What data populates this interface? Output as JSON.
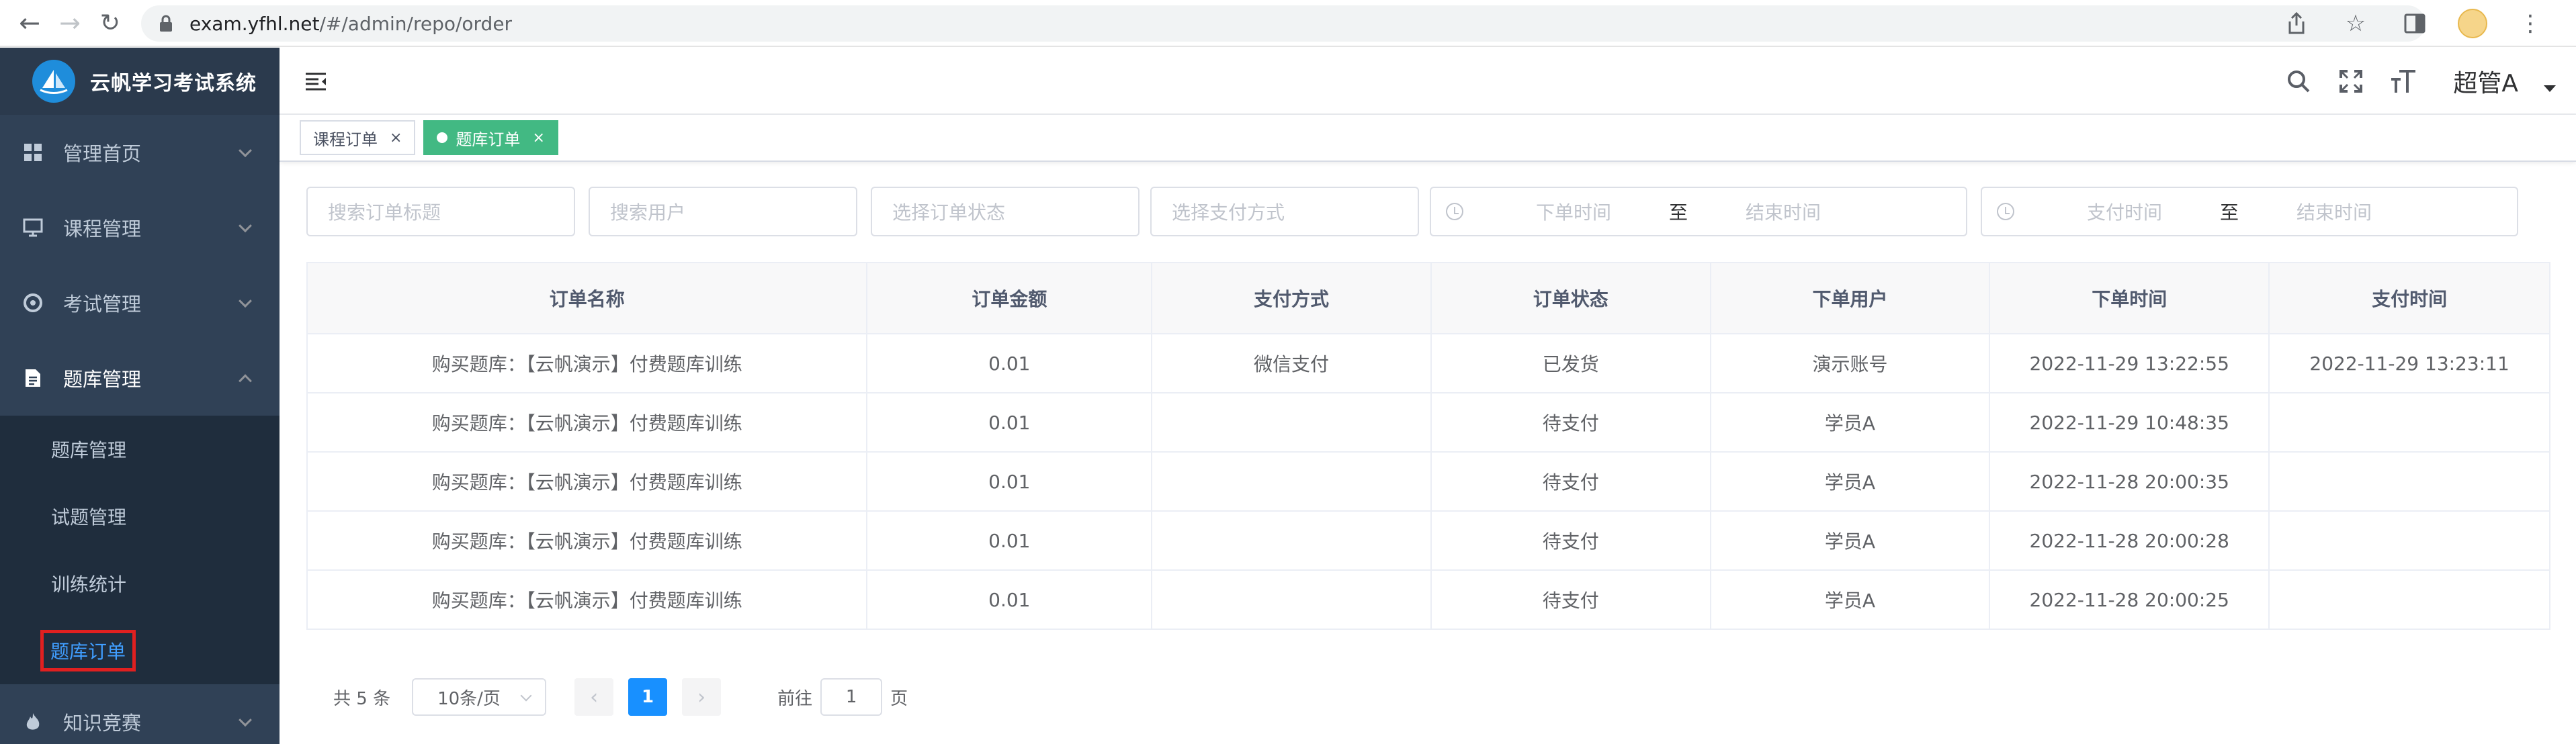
{
  "browser": {
    "domain": "exam.yfhl.net",
    "path": "/#/admin/repo/order"
  },
  "brand": {
    "title": "云帆学习考试系统"
  },
  "sidebar": {
    "items": [
      {
        "label": "管理首页",
        "icon": "dashboard-icon"
      },
      {
        "label": "课程管理",
        "icon": "monitor-icon"
      },
      {
        "label": "考试管理",
        "icon": "exam-icon"
      },
      {
        "label": "题库管理",
        "icon": "document-icon",
        "expanded": true
      }
    ],
    "submenu": [
      {
        "label": "题库管理"
      },
      {
        "label": "试题管理"
      },
      {
        "label": "训练统计"
      },
      {
        "label": "题库订单",
        "active": true
      }
    ],
    "after": [
      {
        "label": "知识竞赛",
        "icon": "fire-icon"
      }
    ]
  },
  "header": {
    "user": "超管A"
  },
  "tags": [
    {
      "label": "课程订单",
      "close": "×"
    },
    {
      "label": "题库订单",
      "close": "×",
      "active": true
    }
  ],
  "filters": {
    "title_placeholder": "搜索订单标题",
    "user_placeholder": "搜索用户",
    "status_placeholder": "选择订单状态",
    "pay_placeholder": "选择支付方式",
    "order_start": "下单时间",
    "order_end": "结束时间",
    "pay_start": "支付时间",
    "pay_end": "结束时间",
    "range_sep": "至"
  },
  "table": {
    "columns": [
      "订单名称",
      "订单金额",
      "支付方式",
      "订单状态",
      "下单用户",
      "下单时间",
      "支付时间"
    ],
    "rows": [
      [
        "购买题库：【云帆演示】付费题库训练",
        "0.01",
        "微信支付",
        "已发货",
        "演示账号",
        "2022-11-29 13:22:55",
        "2022-11-29 13:23:11"
      ],
      [
        "购买题库：【云帆演示】付费题库训练",
        "0.01",
        "",
        "待支付",
        "学员A",
        "2022-11-29 10:48:35",
        ""
      ],
      [
        "购买题库：【云帆演示】付费题库训练",
        "0.01",
        "",
        "待支付",
        "学员A",
        "2022-11-28 20:00:35",
        ""
      ],
      [
        "购买题库：【云帆演示】付费题库训练",
        "0.01",
        "",
        "待支付",
        "学员A",
        "2022-11-28 20:00:28",
        ""
      ],
      [
        "购买题库：【云帆演示】付费题库训练",
        "0.01",
        "",
        "待支付",
        "学员A",
        "2022-11-28 20:00:25",
        ""
      ]
    ]
  },
  "pagination": {
    "total": "共 5 条",
    "page_size": "10条/页",
    "current": "1",
    "goto_label": "前往",
    "goto_value": "1",
    "page_suffix": "页"
  },
  "colors": {
    "sidebar_bg": "#304156",
    "accent": "#1890ff",
    "tag_active": "#42b983",
    "highlight_box": "#e02020"
  }
}
